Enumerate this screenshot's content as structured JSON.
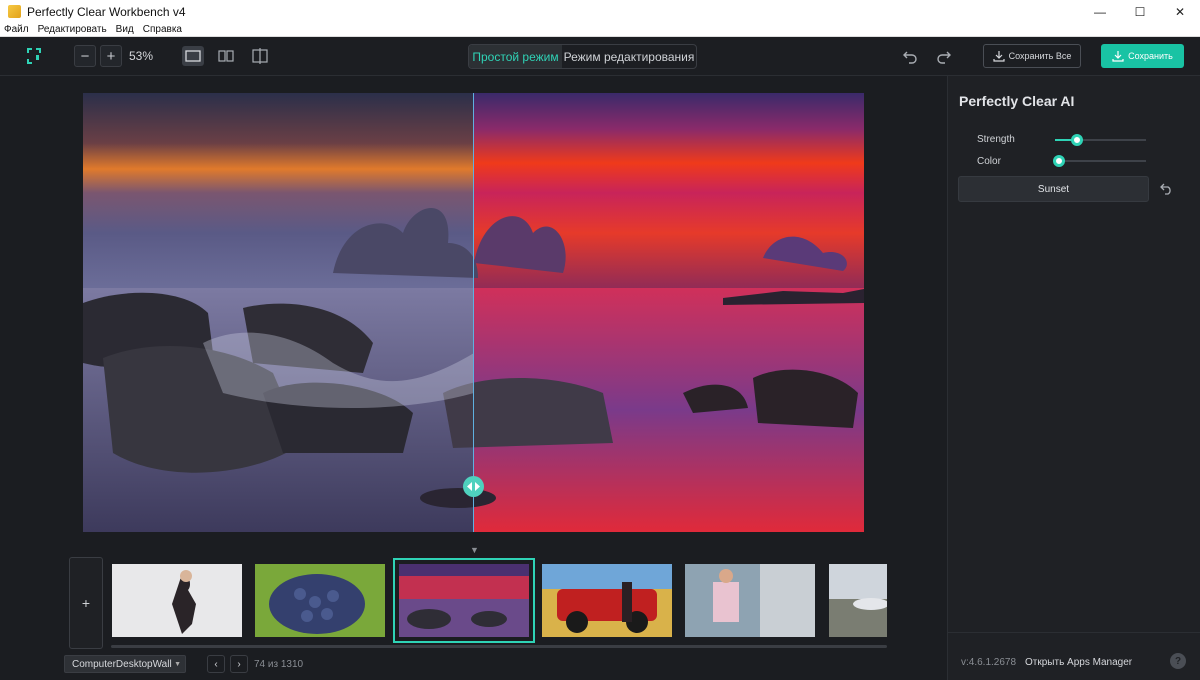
{
  "window": {
    "title": "Perfectly Clear Workbench v4",
    "minimize": "—",
    "maximize": "☐",
    "close": "✕"
  },
  "menu": [
    "Файл",
    "Редактировать",
    "Вид",
    "Справка"
  ],
  "toolbar": {
    "zoom_out": "−",
    "zoom_in": "+",
    "zoom_level": "53%",
    "mode_simple": "Простой режим",
    "mode_edit": "Режим редактирования",
    "save_all": "Сохранить Все",
    "save": "Сохранить"
  },
  "panel": {
    "title": "Perfectly Clear AI",
    "sliders": [
      {
        "label": "Strength",
        "value": 0.2
      },
      {
        "label": "Color",
        "value": 0.0
      }
    ],
    "preset": "Sunset",
    "version": "v:4.6.1.2678",
    "apps_manager": "Открыть Apps Manager",
    "help": "?"
  },
  "filmstrip": {
    "add": "+",
    "folder": "ComputerDesktopWall",
    "prev": "‹",
    "next": "›",
    "counter": "74 из 1310",
    "selected_index": 2
  },
  "colors": {
    "accent": "#2fd3b6",
    "save_bg": "#19c3a4",
    "background": "#1b1d21",
    "panel": "#1f2125"
  }
}
